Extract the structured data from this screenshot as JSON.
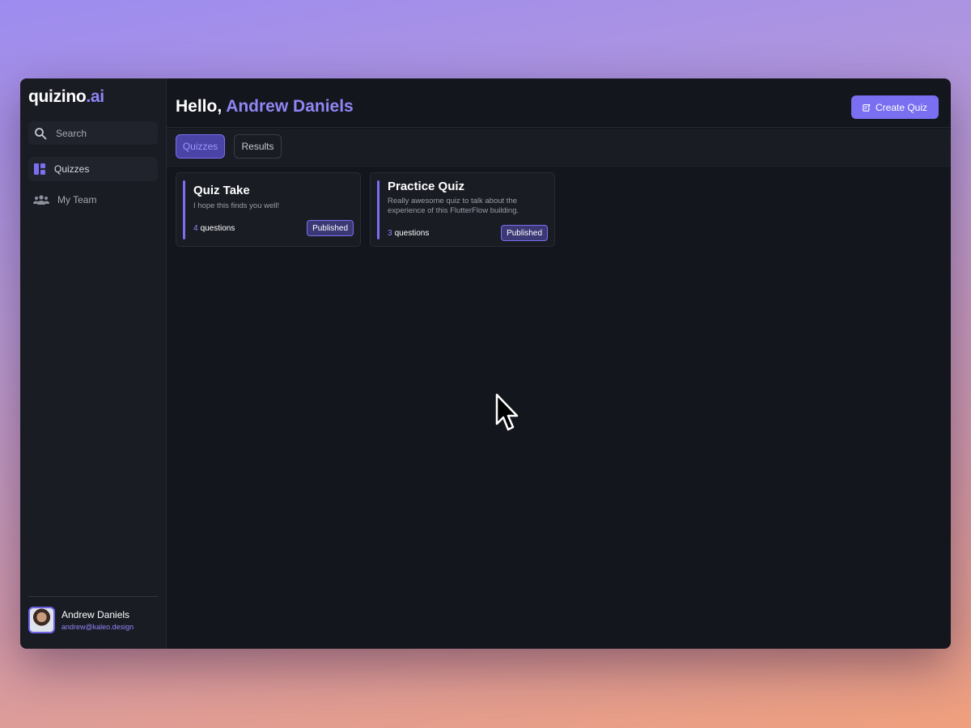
{
  "app": {
    "logo_main": "quizino",
    "logo_accent": ".ai"
  },
  "sidebar": {
    "search_label": "Search",
    "items": [
      {
        "label": "Quizzes",
        "icon": "dashboard-icon",
        "active": true
      },
      {
        "label": "My Team",
        "icon": "team-icon",
        "active": false
      }
    ]
  },
  "profile": {
    "name": "Andrew Daniels",
    "email": "andrew@kaleo.design"
  },
  "header": {
    "greeting": "Hello,",
    "user_name": "Andrew Daniels",
    "create_button": "Create Quiz"
  },
  "tabs": [
    {
      "label": "Quizzes",
      "active": true
    },
    {
      "label": "Results",
      "active": false
    }
  ],
  "quizzes": [
    {
      "title": "Quiz Take",
      "description": "I hope this finds you well!",
      "question_count": "4",
      "question_label": "questions",
      "status": "Published"
    },
    {
      "title": "Practice Quiz",
      "description": "Really awesome quiz to talk about the experience of this FlutterFlow building.",
      "question_count": "3",
      "question_label": "questions",
      "status": "Published"
    }
  ],
  "colors": {
    "accent": "#7a6ff0",
    "accent_text": "#8f86f5",
    "background": "#14161d",
    "sidebar": "#1a1c24"
  }
}
